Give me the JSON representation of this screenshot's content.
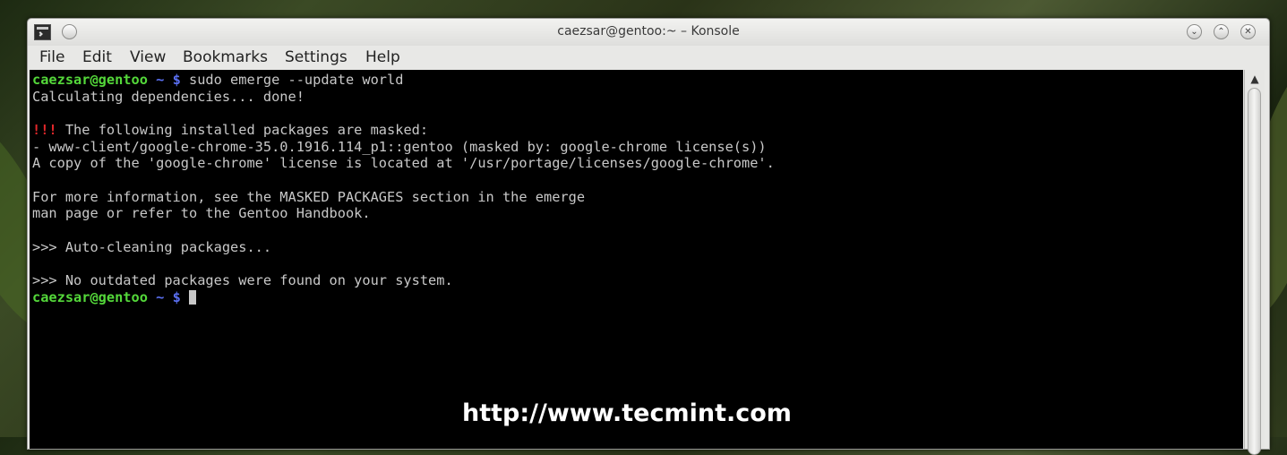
{
  "window": {
    "title": "caezsar@gentoo:~ – Konsole",
    "controls": {
      "minimize": "⌄",
      "maximize": "⌃",
      "close": "✕"
    }
  },
  "menu": [
    {
      "label": "File"
    },
    {
      "label": "Edit"
    },
    {
      "label": "View"
    },
    {
      "label": "Bookmarks"
    },
    {
      "label": "Settings"
    },
    {
      "label": "Help"
    }
  ],
  "terminal": {
    "prompt_user": "caezsar@gentoo",
    "prompt_tilde": " ~ $",
    "command": " sudo emerge --update world",
    "lines": [
      "Calculating dependencies... done!",
      "",
      "!!!",
      " The following installed packages are masked:",
      "- www-client/google-chrome-35.0.1916.114_p1::gentoo (masked by: google-chrome license(s))",
      "A copy of the 'google-chrome' license is located at '/usr/portage/licenses/google-chrome'.",
      "",
      "For more information, see the MASKED PACKAGES section in the emerge",
      "man page or refer to the Gentoo Handbook.",
      "",
      ">>> Auto-cleaning packages...",
      "",
      ">>> No outdated packages were found on your system."
    ]
  },
  "scrollbar": {
    "up_arrow": "▲"
  },
  "watermark": "http://www.tecmint.com",
  "colors": {
    "prompt_user": "#54d83a",
    "prompt_symbol": "#5a6ff0",
    "warning": "#e4282b",
    "terminal_bg": "#000000",
    "terminal_fg": "#c8c8c8"
  }
}
